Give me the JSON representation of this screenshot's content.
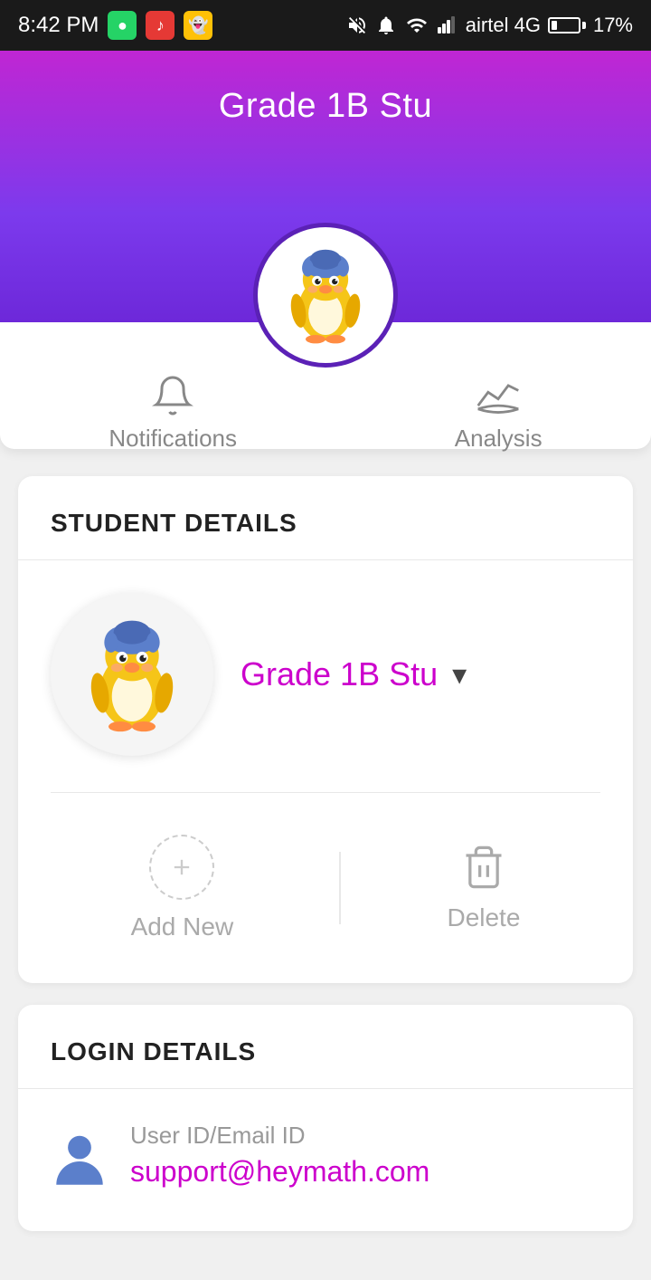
{
  "status_bar": {
    "time": "8:42 PM",
    "carrier": "airtel 4G",
    "battery": "17%",
    "apps": [
      {
        "name": "whatsapp",
        "color": "#25D366",
        "emoji": "💬"
      },
      {
        "name": "music",
        "color": "#e53935",
        "emoji": "🎵"
      },
      {
        "name": "snapchat",
        "color": "#FFC107",
        "emoji": "👻"
      }
    ]
  },
  "header": {
    "title": "Grade 1B Stu"
  },
  "tabs": [
    {
      "id": "notifications",
      "label": "Notifications"
    },
    {
      "id": "analysis",
      "label": "Analysis"
    }
  ],
  "student_details": {
    "section_title": "STUDENT DETAILS",
    "student_name": "Grade 1B Stu",
    "add_label": "Add New",
    "delete_label": "Delete"
  },
  "login_details": {
    "section_title": "LOGIN DETAILS",
    "label": "User ID/Email ID",
    "email": "support@heymath.com"
  },
  "colors": {
    "purple": "#cc00cc",
    "gradient_top": "#c026d3",
    "gradient_bottom": "#6d28d9"
  }
}
